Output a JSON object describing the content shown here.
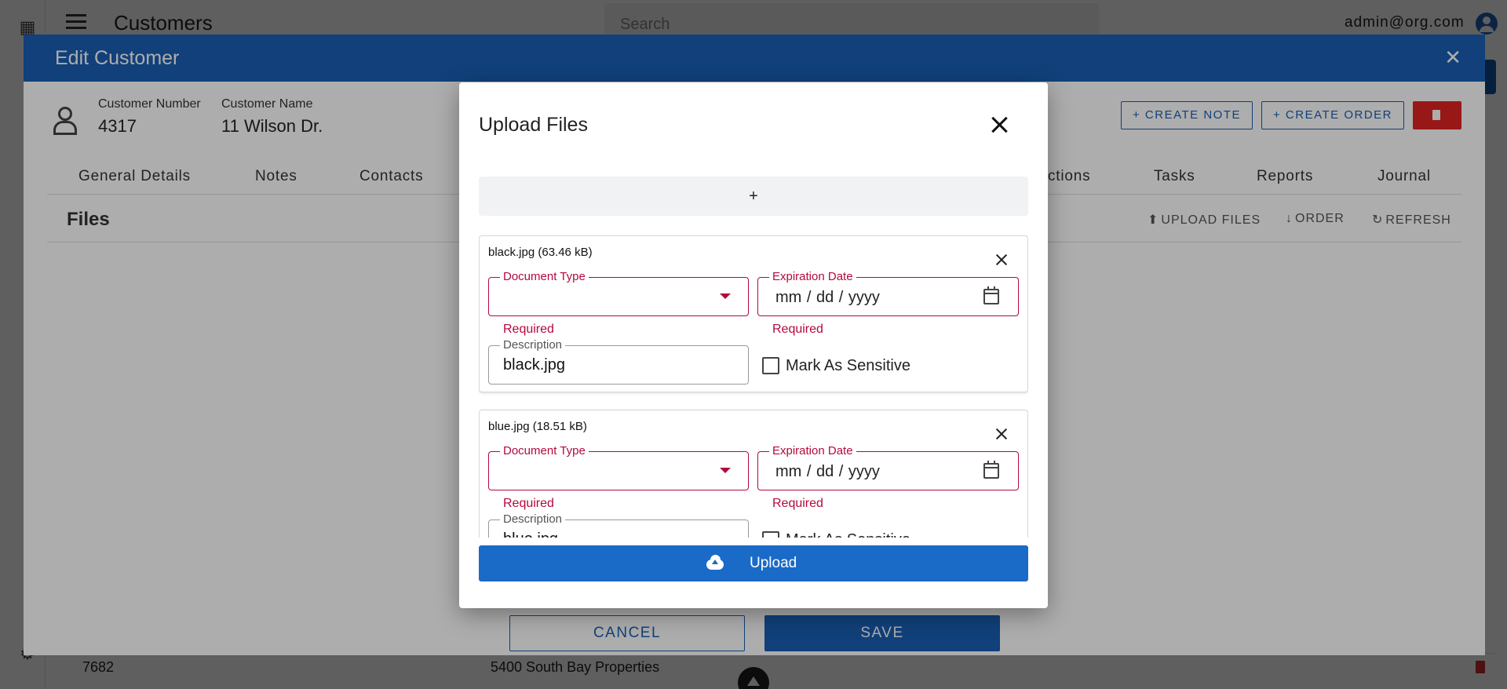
{
  "app": {
    "title": "Customers",
    "search_placeholder": "Search",
    "user_email": "admin@org.com"
  },
  "background_row": {
    "id": "7682",
    "name": "5400 South Bay Properties"
  },
  "edit_customer": {
    "title": "Edit Customer",
    "customer_number_label": "Customer Number",
    "customer_number": "4317",
    "customer_name_label": "Customer Name",
    "customer_name": "11 Wilson Dr.",
    "create_note_label": "+ CREATE NOTE",
    "create_order_label": "+ CREATE ORDER",
    "tabs": [
      {
        "label": "General Details"
      },
      {
        "label": "Notes"
      },
      {
        "label": "Contacts"
      },
      {
        "label": "ctions"
      },
      {
        "label": "Tasks"
      },
      {
        "label": "Reports"
      },
      {
        "label": "Journal"
      }
    ],
    "files_heading": "Files",
    "upload_files_label": "UPLOAD FILES",
    "order_label": "ORDER",
    "refresh_label": "REFRESH",
    "cancel_label": "CANCEL",
    "save_label": "SAVE"
  },
  "upload_modal": {
    "title": "Upload Files",
    "add_label": "+",
    "upload_label": "Upload",
    "files": [
      {
        "name": "black.jpg (63.46 kB)",
        "document_type_label": "Document Type",
        "document_type_value": "",
        "document_type_helper": "Required",
        "expiration_label": "Expiration Date",
        "expiration_placeholder": "mm / dd / yyyy",
        "expiration_helper": "Required",
        "description_label": "Description",
        "description_value": "black.jpg",
        "sensitive_label": "Mark As Sensitive",
        "sensitive_checked": false
      },
      {
        "name": "blue.jpg (18.51 kB)",
        "document_type_label": "Document Type",
        "document_type_value": "",
        "document_type_helper": "Required",
        "expiration_label": "Expiration Date",
        "expiration_placeholder": "mm / dd / yyyy",
        "expiration_helper": "Required",
        "description_label": "Description",
        "description_value": "blue.jpg",
        "sensitive_label": "Mark As Sensitive",
        "sensitive_checked": false
      }
    ]
  },
  "colors": {
    "primary": "#1a5fb4",
    "error": "#b3093c",
    "danger": "#e02424"
  }
}
